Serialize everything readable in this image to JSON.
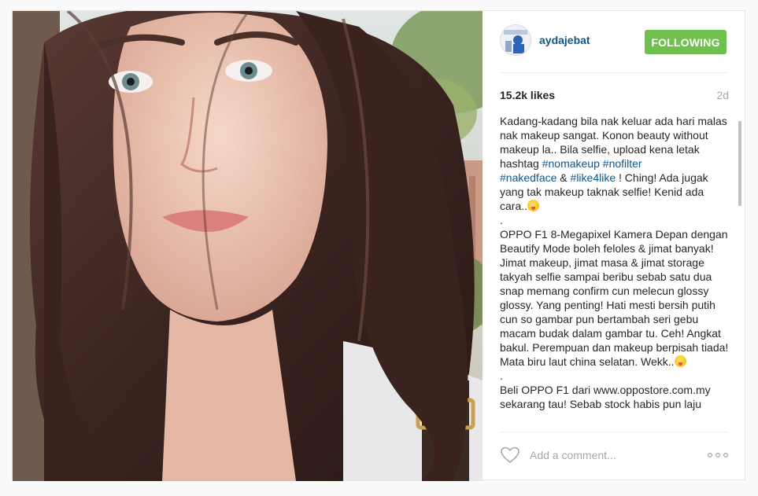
{
  "post": {
    "username": "aydajebat",
    "follow_label": "FOLLOWING",
    "likes": "15.2k likes",
    "age": "2d",
    "caption": [
      {
        "t": "Kadang-kadang bila nak keluar ada hari malas nak makeup sangat. Konon beauty without makeup la.. Bila selfie, upload kena letak hashtag "
      },
      {
        "t": "#nomakeup",
        "tag": true
      },
      {
        "t": " "
      },
      {
        "t": "#nofilter",
        "tag": true
      },
      {
        "t": "\n"
      },
      {
        "t": "#nakedface",
        "tag": true
      },
      {
        "t": " & "
      },
      {
        "t": "#like4like",
        "tag": true
      },
      {
        "t": " ! Ching! Ada jugak yang tak makeup taknak selfie! Kenid ada cara.."
      },
      {
        "emoji": "tongue-emoji"
      },
      {
        "t": "\n.\nOPPO F1 8-Megapixel Kamera Depan dengan Beautify Mode boleh feloles & jimat banyak! Jimat makeup, jimat masa & jimat storage takyah selfie sampai beribu sebab satu dua snap memang confirm cun melecun glossy glossy. Yang penting! Hati mesti bersih putih cun so gambar pun bertambah seri gebu macam budak dalam gambar tu. Ceh! Angkat bakul. Perempuan dan makeup berpisah tiada! Mata biru laut china selatan. Wekk.."
      },
      {
        "emoji": "tongue-emoji"
      },
      {
        "t": "\n.\nBeli OPPO F1 dari www.oppostore.com.my sekarang tau! Sebab stock habis pun laju"
      }
    ],
    "comment_placeholder": "Add a comment...",
    "icons": {
      "heart": "heart-icon",
      "more": "more-options-icon"
    },
    "colors": {
      "follow_bg": "#70c050",
      "username": "#125688",
      "hashtag": "#125688"
    }
  }
}
